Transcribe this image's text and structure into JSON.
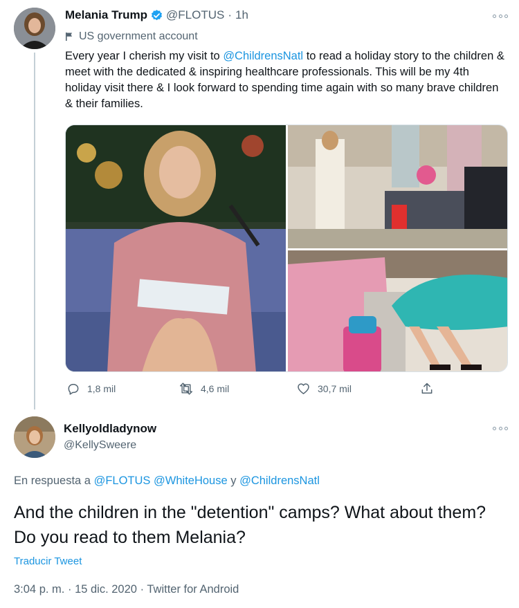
{
  "tweet": {
    "author_name": "Melania Trump",
    "handle": "@FLOTUS",
    "separator": "·",
    "time": "1h",
    "gov_label": "US government account",
    "text_before": "Every year I cherish my visit to ",
    "mention": "@ChildrensNatl",
    "text_after": " to read a holiday story to the children & meet with the dedicated & inspiring healthcare professionals. This will be my 4th holiday visit there & I look forward to spending time again with so many brave children & their families.",
    "stats": {
      "replies": "1,8 mil",
      "retweets": "4,6 mil",
      "likes": "30,7 mil"
    }
  },
  "reply": {
    "author_name": "Kellyoldladynow",
    "handle": "@KellySweere",
    "replying_prefix": "En respuesta a",
    "replying_to": [
      "@FLOTUS",
      "@WhiteHouse"
    ],
    "replying_and": "y",
    "replying_last": "@ChildrensNatl",
    "text": "And the children in the \"detention\" camps? What about them? Do you read to them Melania?",
    "translate": "Traducir Tweet",
    "time": "3:04 p. m.",
    "date": "15 dic. 2020",
    "dot": "·",
    "client": "Twitter for Android"
  },
  "colors": {
    "accent": "#1b95e0",
    "verified": "#1da1f2",
    "muted": "#536471"
  },
  "icons": [
    "verified-badge-icon",
    "flag-icon",
    "more-icon",
    "reply-icon",
    "retweet-icon",
    "like-icon",
    "share-icon"
  ]
}
